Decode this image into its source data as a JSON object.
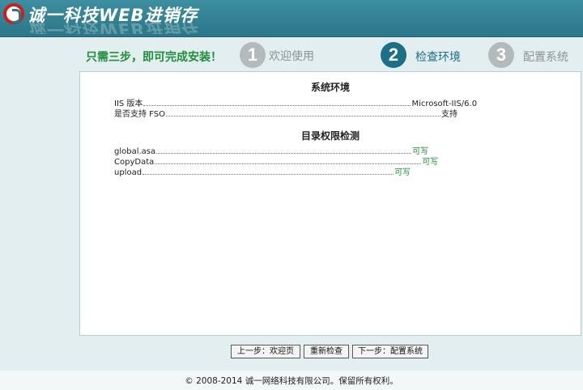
{
  "header": {
    "title": "诚一科技WEB进销存"
  },
  "steps": {
    "intro": "只需三步，即可完成安装！",
    "items": [
      {
        "num": "1",
        "label": "欢迎使用",
        "state": "done"
      },
      {
        "num": "2",
        "label": "检查环境",
        "state": "active"
      },
      {
        "num": "3",
        "label": "配置系统",
        "state": "pending"
      }
    ]
  },
  "env": {
    "title": "系统环境",
    "rows": [
      {
        "name": "IIS 版本",
        "value": "Microsoft-IIS/6.0"
      },
      {
        "name": "是否支持 FSO",
        "value": "支持"
      }
    ]
  },
  "perm": {
    "title": "目录权限检测",
    "rows": [
      {
        "name": "global.asa",
        "value": "可写"
      },
      {
        "name": "CopyData",
        "value": "可写"
      },
      {
        "name": "upload",
        "value": "可写"
      }
    ]
  },
  "buttons": {
    "prev": "上一步：欢迎页",
    "recheck": "重新检查",
    "next": "下一步：配置系统"
  },
  "footer": {
    "text": "© 2008-2014 诚一网络科技有限公司。保留所有权利。"
  },
  "colors": {
    "header": "#2c7688",
    "accent": "#1c6f84",
    "ok": "#1f8d3a",
    "background": "#e3eef1"
  }
}
